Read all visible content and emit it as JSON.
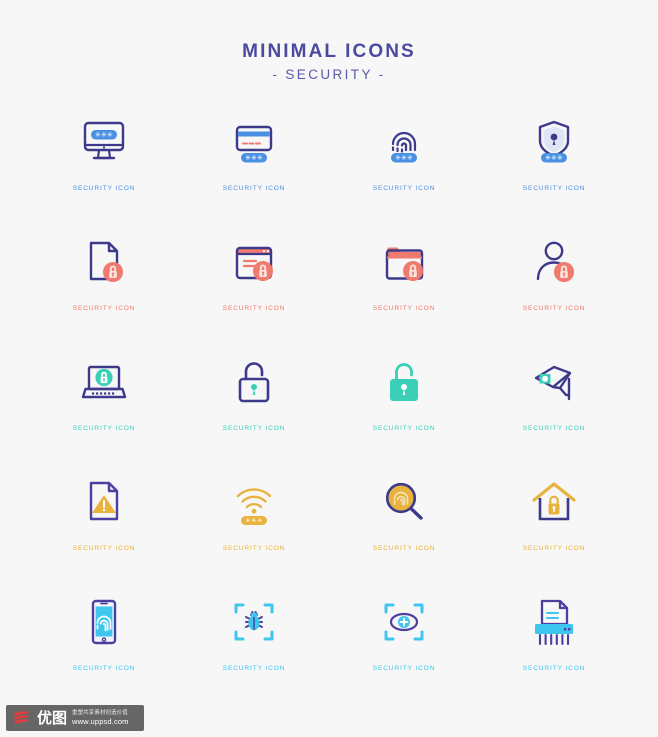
{
  "header": {
    "title": "MINIMAL ICONS",
    "subtitle": "- SECURITY -"
  },
  "colors": {
    "background": "#f7f7f7",
    "outline_navy": "#3d3a8c",
    "title_purple": "#4b4a9e",
    "accent_blue": "#4a90e2",
    "accent_red": "#ef7a6d",
    "accent_teal": "#3ccfb8",
    "accent_orange": "#e8b23c",
    "accent_cyan": "#3ec6ef"
  },
  "icons": [
    {
      "name": "monitor-password",
      "label": "SECURITY ICON",
      "accent": "blue"
    },
    {
      "name": "credit-card-password",
      "label": "SECURITY ICON",
      "accent": "blue"
    },
    {
      "name": "fingerprint-password",
      "label": "SECURITY ICON",
      "accent": "blue"
    },
    {
      "name": "shield-keyhole",
      "label": "SECURITY ICON",
      "accent": "blue"
    },
    {
      "name": "document-lock",
      "label": "SECURITY ICON",
      "accent": "red"
    },
    {
      "name": "browser-window-lock",
      "label": "SECURITY ICON",
      "accent": "red"
    },
    {
      "name": "folder-lock",
      "label": "SECURITY ICON",
      "accent": "red"
    },
    {
      "name": "user-lock",
      "label": "SECURITY ICON",
      "accent": "red"
    },
    {
      "name": "laptop-lock",
      "label": "SECURITY ICON",
      "accent": "teal"
    },
    {
      "name": "padlock-open",
      "label": "SECURITY ICON",
      "accent": "teal"
    },
    {
      "name": "padlock-closed",
      "label": "SECURITY ICON",
      "accent": "teal"
    },
    {
      "name": "cctv-camera",
      "label": "SECURITY ICON",
      "accent": "teal"
    },
    {
      "name": "document-warning",
      "label": "SECURITY ICON",
      "accent": "orange"
    },
    {
      "name": "wifi-password",
      "label": "SECURITY ICON",
      "accent": "orange"
    },
    {
      "name": "fingerprint-search",
      "label": "SECURITY ICON",
      "accent": "orange"
    },
    {
      "name": "house-lock",
      "label": "SECURITY ICON",
      "accent": "orange"
    },
    {
      "name": "smartphone-fingerprint",
      "label": "SECURITY ICON",
      "accent": "cyan"
    },
    {
      "name": "bug-scan",
      "label": "SECURITY ICON",
      "accent": "cyan"
    },
    {
      "name": "eye-scan",
      "label": "SECURITY ICON",
      "accent": "cyan"
    },
    {
      "name": "paper-shredder",
      "label": "SECURITY ICON",
      "accent": "cyan"
    }
  ],
  "watermark": {
    "logo": "uppsd-logo-icon",
    "brand_cn": "优图",
    "tagline_cn": "重塑共享素材创造价值",
    "url": "www.uppsd.com"
  }
}
